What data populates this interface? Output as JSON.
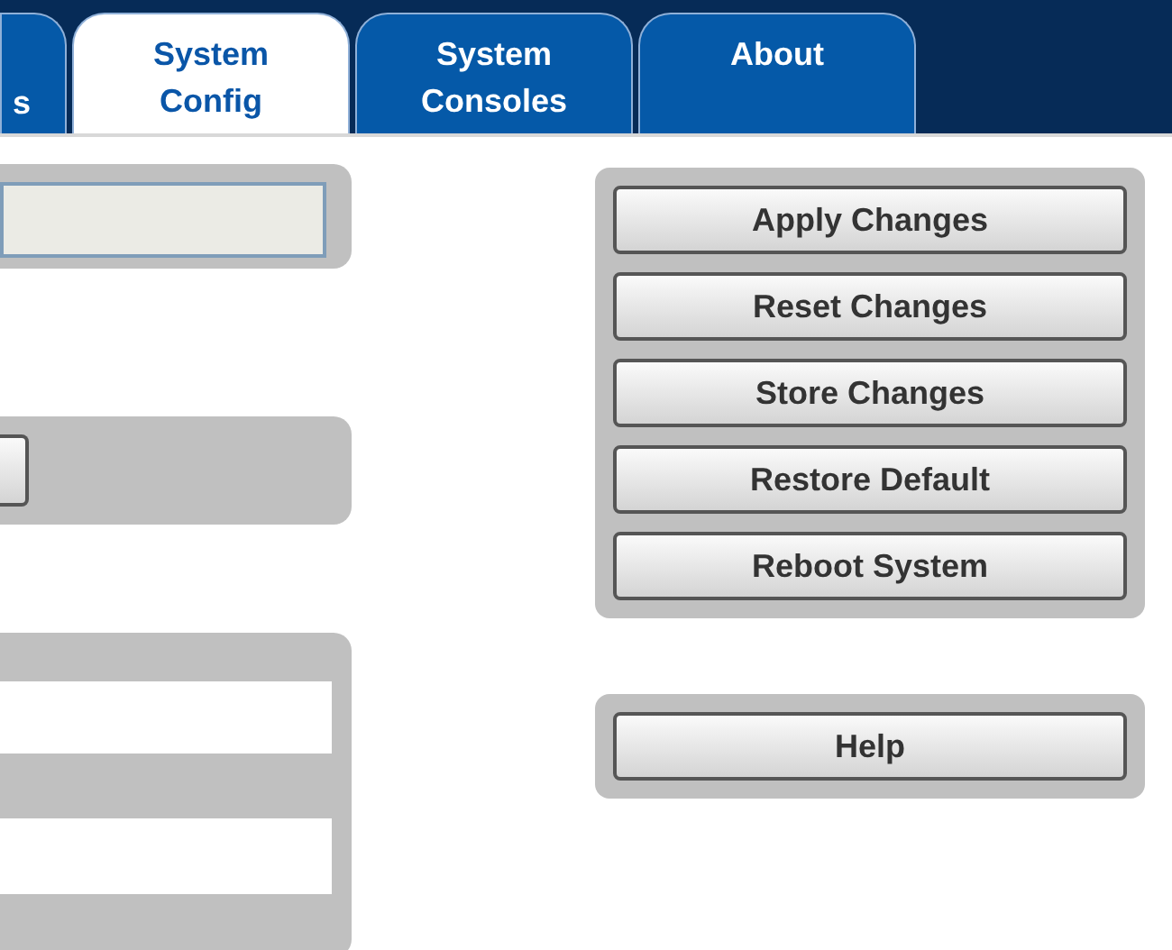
{
  "tabs": [
    {
      "lines": [
        "s"
      ],
      "selected": false,
      "partial": true
    },
    {
      "lines": [
        "System",
        "Config"
      ],
      "selected": true,
      "partial": false
    },
    {
      "lines": [
        "System",
        "Consoles"
      ],
      "selected": false,
      "partial": false
    },
    {
      "lines": [
        "About"
      ],
      "selected": false,
      "partial": false
    }
  ],
  "left_panels": [
    {
      "kind": "field"
    },
    {
      "kind": "button"
    },
    {
      "kind": "fields"
    }
  ],
  "actions": [
    "Apply Changes",
    "Reset Changes",
    "Store Changes",
    "Restore Default",
    "Reboot System"
  ],
  "help": "Help"
}
